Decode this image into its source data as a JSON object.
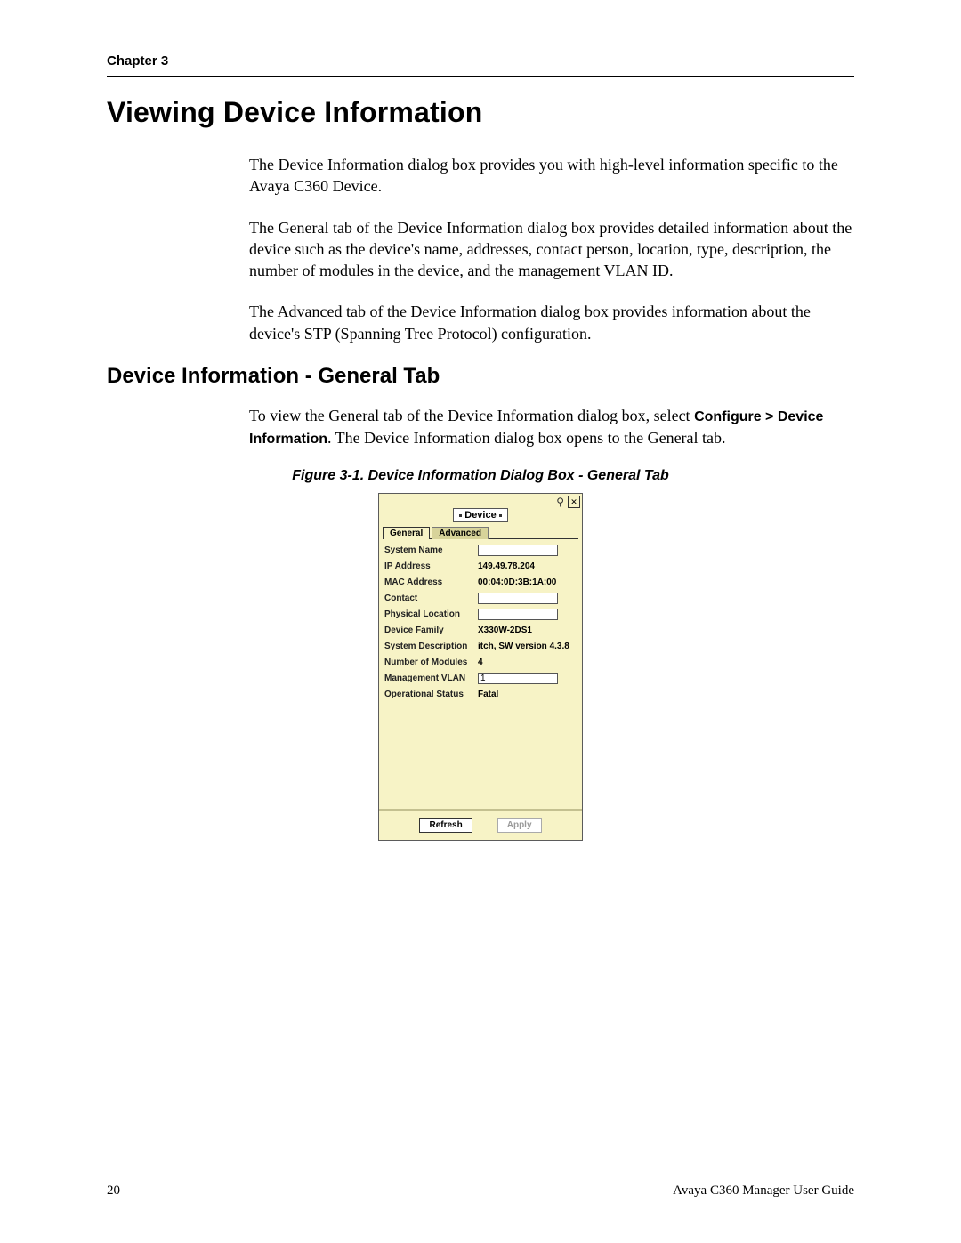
{
  "header": {
    "chapter_label": "Chapter 3"
  },
  "title": "Viewing Device Information",
  "paragraphs": {
    "p1": "The Device Information dialog box provides you with high-level information specific to the Avaya C360 Device.",
    "p2": "The General tab of the Device Information dialog box provides detailed information about the device such as the device's name, addresses, contact person, location, type, description, the number of modules in the device, and the management VLAN ID.",
    "p3": "The Advanced tab of the Device Information dialog box provides information about the device's STP (Spanning Tree Protocol) configuration."
  },
  "subtitle": "Device Information - General Tab",
  "instruction": {
    "lead": "To view the General tab of the Device Information dialog box, select ",
    "menu_path": "Configure > Device Information",
    "tail": ". The Device Information dialog box opens to the General tab."
  },
  "figure_caption": "Figure 3-1.  Device Information Dialog Box - General Tab",
  "dialog": {
    "close_glyph": "✕",
    "pin_glyph": "⚲",
    "title": "Device",
    "tabs": {
      "general": "General",
      "advanced": "Advanced"
    },
    "fields": {
      "system_name": {
        "label": "System Name",
        "value": ""
      },
      "ip_address": {
        "label": "IP Address",
        "value": "149.49.78.204"
      },
      "mac_address": {
        "label": "MAC Address",
        "value": "00:04:0D:3B:1A:00"
      },
      "contact": {
        "label": "Contact",
        "value": ""
      },
      "physical_location": {
        "label": "Physical Location",
        "value": ""
      },
      "device_family": {
        "label": "Device Family",
        "value": "X330W-2DS1"
      },
      "system_description": {
        "label": "System Description",
        "value": "itch, SW version 4.3.8"
      },
      "number_of_modules": {
        "label": "Number of Modules",
        "value": "4"
      },
      "management_vlan": {
        "label": "Management VLAN",
        "value": "1"
      },
      "operational_status": {
        "label": "Operational Status",
        "value": "Fatal"
      }
    },
    "buttons": {
      "refresh": "Refresh",
      "apply": "Apply"
    }
  },
  "footer": {
    "page_number": "20",
    "book_title": "Avaya C360 Manager User Guide"
  }
}
